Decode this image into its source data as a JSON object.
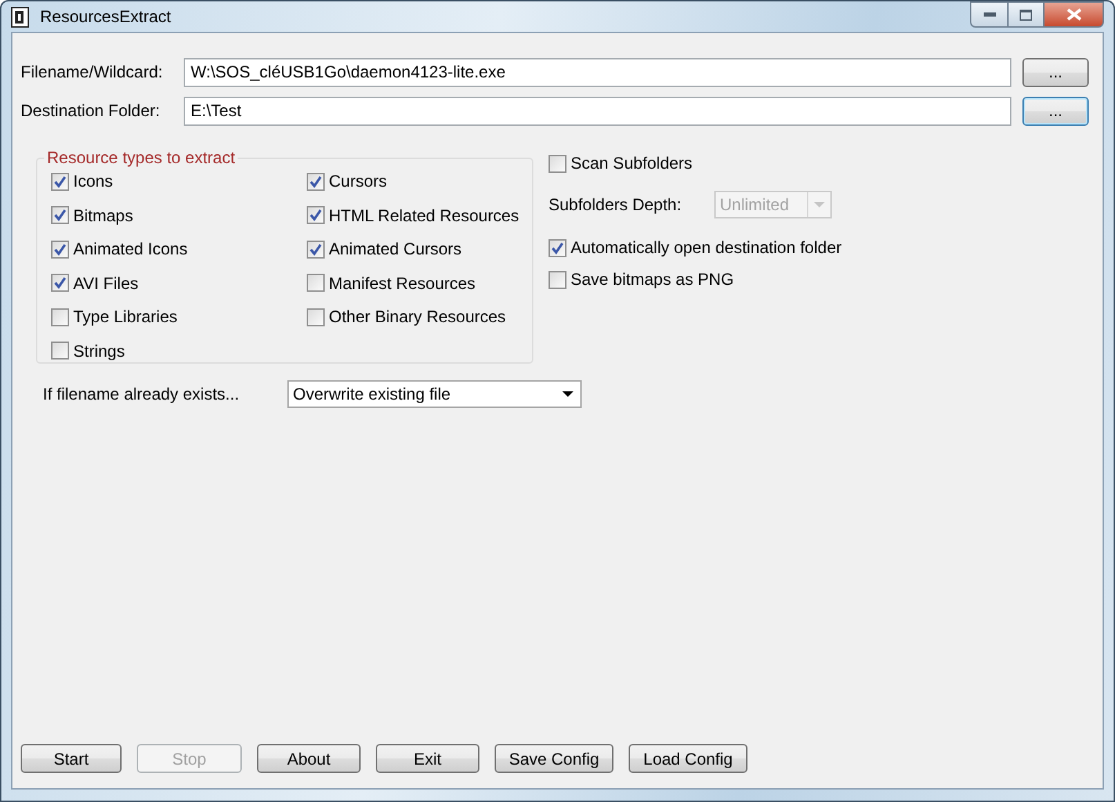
{
  "window": {
    "title": "ResourcesExtract"
  },
  "paths": [
    {
      "label": "Filename/Wildcard:",
      "value": "W:\\SOS_cléUSB1Go\\daemon4123-lite.exe",
      "browse": "...",
      "focused": false
    },
    {
      "label": "Destination Folder:",
      "value": "E:\\Test",
      "browse": "...",
      "focused": true
    }
  ],
  "resource_types": {
    "title": "Resource types to extract",
    "options": [
      {
        "label": "Icons",
        "checked": true
      },
      {
        "label": "Cursors",
        "checked": true
      },
      {
        "label": "Bitmaps",
        "checked": true
      },
      {
        "label": "HTML Related Resources",
        "checked": true
      },
      {
        "label": "Animated Icons",
        "checked": true
      },
      {
        "label": "Animated Cursors",
        "checked": true
      },
      {
        "label": "AVI Files",
        "checked": true
      },
      {
        "label": "Manifest Resources",
        "checked": false
      },
      {
        "label": "Type Libraries",
        "checked": false
      },
      {
        "label": "Other Binary Resources",
        "checked": false
      },
      {
        "label": "Strings",
        "checked": false
      }
    ]
  },
  "options": [
    {
      "kind": "checkbox",
      "label": "Scan Subfolders",
      "checked": false
    },
    {
      "kind": "dropdown",
      "label": "Subfolders Depth:",
      "value": "Unlimited",
      "disabled": true
    },
    {
      "kind": "checkbox",
      "label": "Automatically open destination folder",
      "checked": true
    },
    {
      "kind": "checkbox",
      "label": "Save bitmaps as PNG",
      "checked": false
    }
  ],
  "if_exists": {
    "label": "If filename already exists...",
    "value": "Overwrite existing file",
    "disabled": false
  },
  "buttons": [
    {
      "label": "Start",
      "disabled": false
    },
    {
      "label": "Stop",
      "disabled": true
    },
    {
      "label": "About",
      "disabled": false
    },
    {
      "label": "Exit",
      "disabled": false
    },
    {
      "label": "Save Config",
      "disabled": false
    },
    {
      "label": "Load Config",
      "disabled": false
    }
  ]
}
